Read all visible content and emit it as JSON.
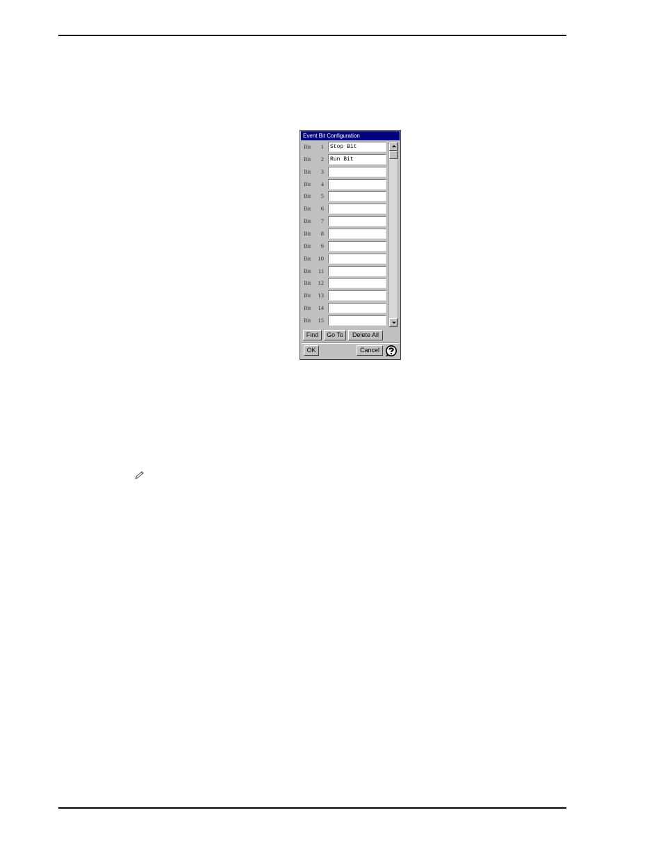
{
  "dialog": {
    "title": "Event Bit Configuration",
    "bit_prefix": "Bit",
    "bits": [
      {
        "num": "1",
        "value": "Stop Bit"
      },
      {
        "num": "2",
        "value": "Run Bit"
      },
      {
        "num": "3",
        "value": ""
      },
      {
        "num": "4",
        "value": ""
      },
      {
        "num": "5",
        "value": ""
      },
      {
        "num": "6",
        "value": ""
      },
      {
        "num": "7",
        "value": ""
      },
      {
        "num": "8",
        "value": ""
      },
      {
        "num": "9",
        "value": ""
      },
      {
        "num": "10",
        "value": ""
      },
      {
        "num": "11",
        "value": ""
      },
      {
        "num": "12",
        "value": ""
      },
      {
        "num": "13",
        "value": ""
      },
      {
        "num": "14",
        "value": ""
      },
      {
        "num": "15",
        "value": ""
      }
    ],
    "buttons": {
      "find": "Find",
      "goto": "Go To",
      "delete_all": "Delete All",
      "ok": "OK",
      "cancel": "Cancel"
    },
    "icons": {
      "help": "help-icon",
      "scroll_up": "scroll-up-icon",
      "scroll_down": "scroll-down-icon"
    }
  },
  "page": {
    "note_icon": "pencil-icon"
  }
}
